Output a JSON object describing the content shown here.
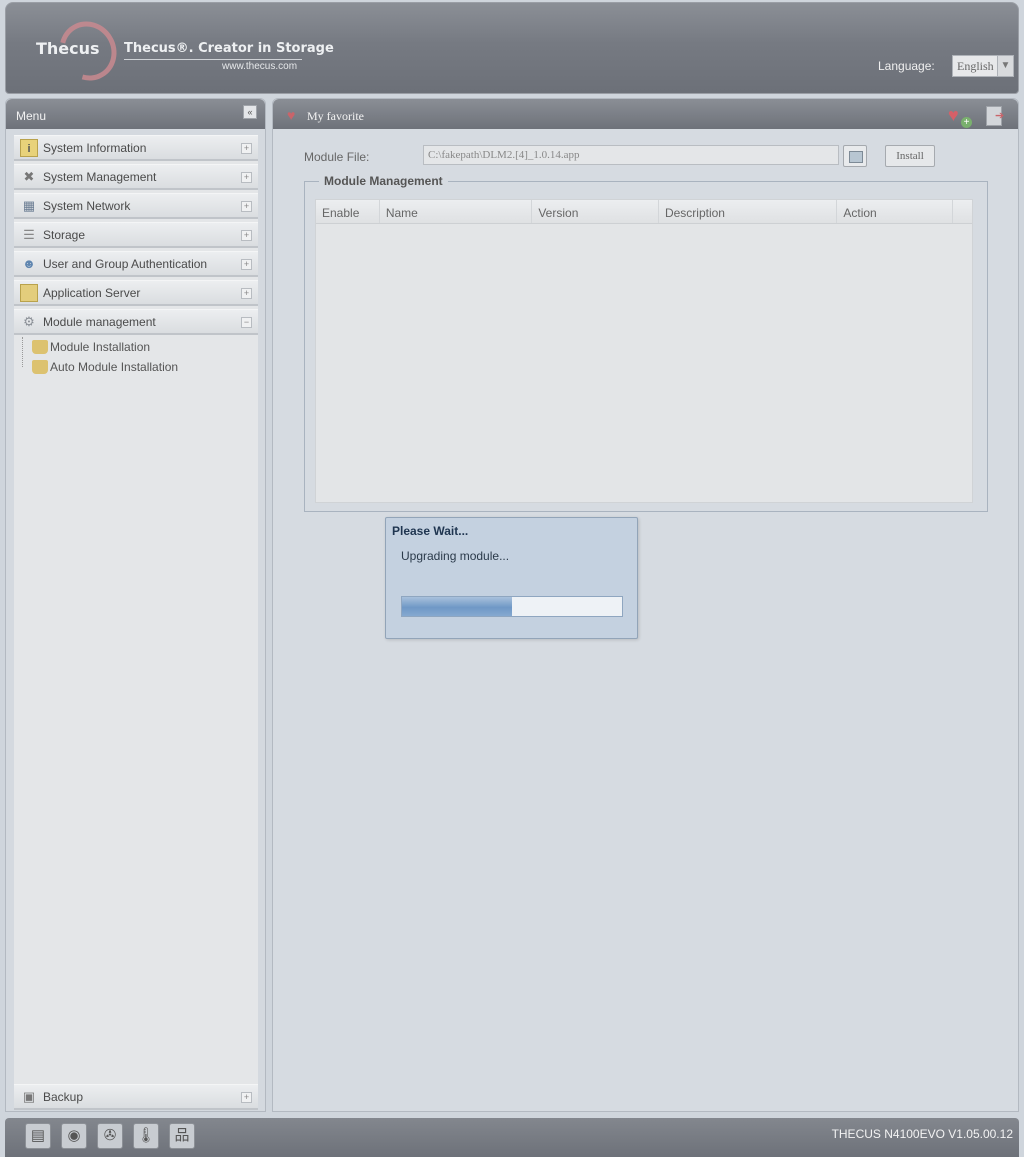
{
  "header": {
    "logo_text": "Thecus",
    "tagline": "Thecus®. Creator in Storage",
    "site": "www.thecus.com",
    "language_label": "Language:",
    "language_value": "English"
  },
  "menu": {
    "title": "Menu",
    "items": [
      {
        "label": "System Information",
        "icon": "info-icon"
      },
      {
        "label": "System Management",
        "icon": "tools-icon"
      },
      {
        "label": "System Network",
        "icon": "network-icon"
      },
      {
        "label": "Storage",
        "icon": "storage-icon"
      },
      {
        "label": "User and Group Authentication",
        "icon": "users-icon"
      },
      {
        "label": "Application Server",
        "icon": "app-server-icon"
      },
      {
        "label": "Module management",
        "icon": "gears-icon"
      }
    ],
    "subitems": [
      {
        "label": "Module Installation",
        "icon": "module-icon"
      },
      {
        "label": "Auto Module Installation",
        "icon": "module-icon"
      }
    ],
    "backup": "Backup"
  },
  "main": {
    "favorite": "My favorite",
    "module_file_label": "Module File:",
    "module_file_value": "C:\\fakepath\\DLM2.[4]_1.0.14.app",
    "install_label": "Install",
    "section_title": "Module Management",
    "columns": [
      "Enable",
      "Name",
      "Version",
      "Description",
      "Action"
    ]
  },
  "dialog": {
    "title": "Please Wait...",
    "message": "Upgrading module...",
    "progress": 0.5
  },
  "footer": {
    "version": "THECUS N4100EVO V1.05.00.12"
  },
  "colors": {
    "header_gray": "#767a82",
    "dialog_blue": "#c4d1e0",
    "progress_blue": "#6f98c6"
  }
}
